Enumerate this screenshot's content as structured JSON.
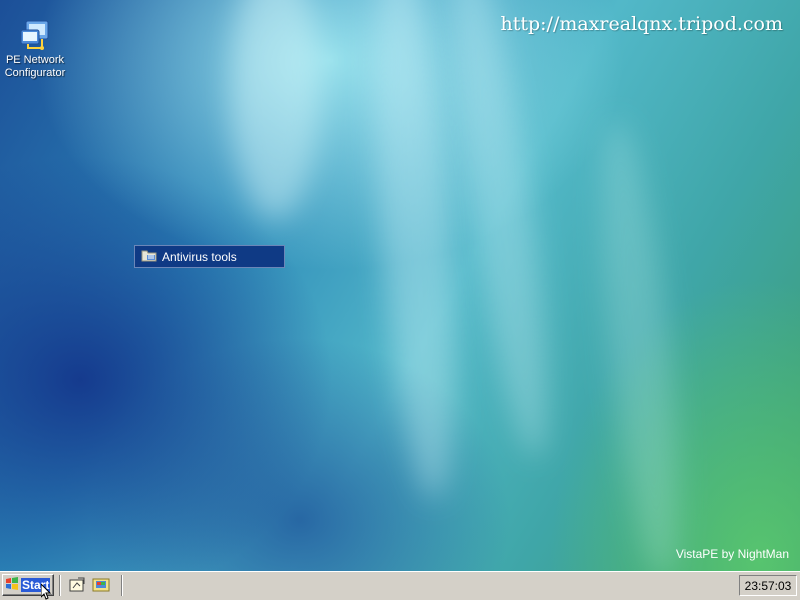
{
  "desktop": {
    "watermark_url": "http://maxrealqnx.tripod.com",
    "branding": "VistaPE by NightMan",
    "icons": [
      {
        "label": "PE Network Configurator",
        "icon": "network-configurator-icon"
      }
    ],
    "selected_item": {
      "label": "Antivirus tools",
      "icon": "folder-icon"
    }
  },
  "taskbar": {
    "start_label": "Start",
    "quick_launch": [
      "show-desktop-icon",
      "explorer-icon"
    ],
    "clock": "23:57:03"
  },
  "colors": {
    "selection": "#0f3a85",
    "taskbar": "#d4d0c8"
  }
}
